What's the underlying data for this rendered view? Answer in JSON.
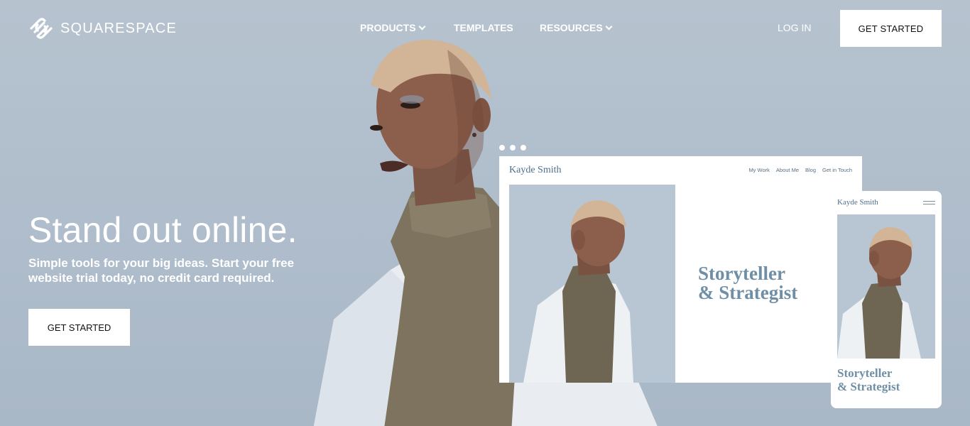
{
  "header": {
    "brand": "SQUARESPACE",
    "nav": [
      {
        "label": "PRODUCTS",
        "has_dropdown": true
      },
      {
        "label": "TEMPLATES",
        "has_dropdown": false
      },
      {
        "label": "RESOURCES",
        "has_dropdown": true
      }
    ],
    "login_label": "LOG IN",
    "cta_label": "GET STARTED"
  },
  "hero": {
    "headline": "Stand out online.",
    "subtext": "Simple tools for your big ideas. Start your free website trial today, no credit card required.",
    "cta_label": "GET STARTED"
  },
  "desktop_mock": {
    "brand": "Kayde Smith",
    "nav": [
      "My Work",
      "About Me",
      "Blog",
      "Get in Touch"
    ],
    "title_line1": "Storyteller",
    "title_line2": "& Strategist"
  },
  "mobile_mock": {
    "brand": "Kayde Smith",
    "title_line1": "Storyteller",
    "title_line2": "& Strategist"
  },
  "icons": {
    "logo": "squarespace-logo-icon",
    "dropdown": "chevron-down-icon",
    "menu": "hamburger-menu-icon"
  },
  "colors": {
    "background": "#b1bfcc",
    "accent_text": "#6f8fa6",
    "button_bg": "#ffffff",
    "button_text": "#111111"
  }
}
